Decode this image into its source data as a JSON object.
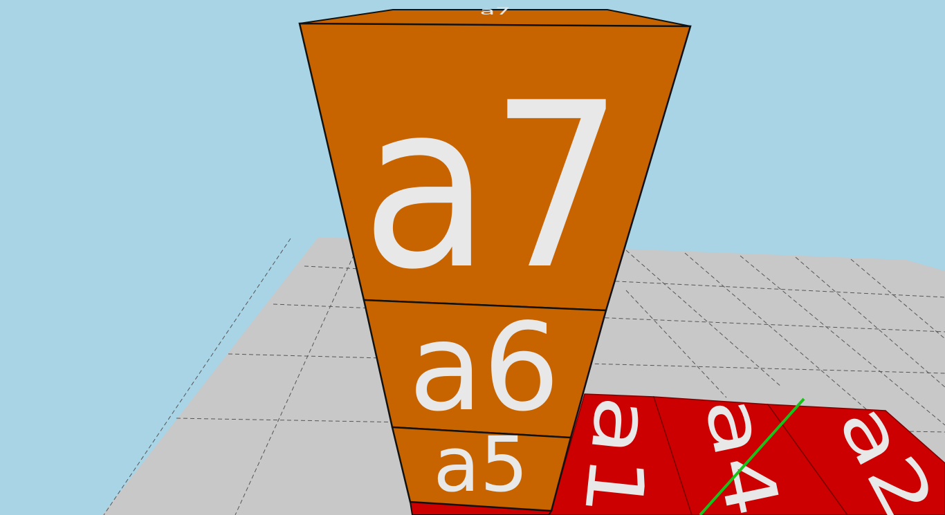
{
  "scene": {
    "colors": {
      "sky": "#a8d4e6",
      "floor": "#c8c8c8",
      "tower_face": "#c86400",
      "floor_tile": "#cc0000",
      "edge": "#111111",
      "axis_line": "#19c219",
      "label": "#e8e8e8"
    },
    "tower_blocks": [
      {
        "label": "a7"
      },
      {
        "label": "a6"
      },
      {
        "label": "a5"
      }
    ],
    "tower_top_label": "a7",
    "floor_tiles": [
      {
        "label": "a1"
      },
      {
        "label": "a4"
      },
      {
        "label": "a2"
      }
    ]
  }
}
